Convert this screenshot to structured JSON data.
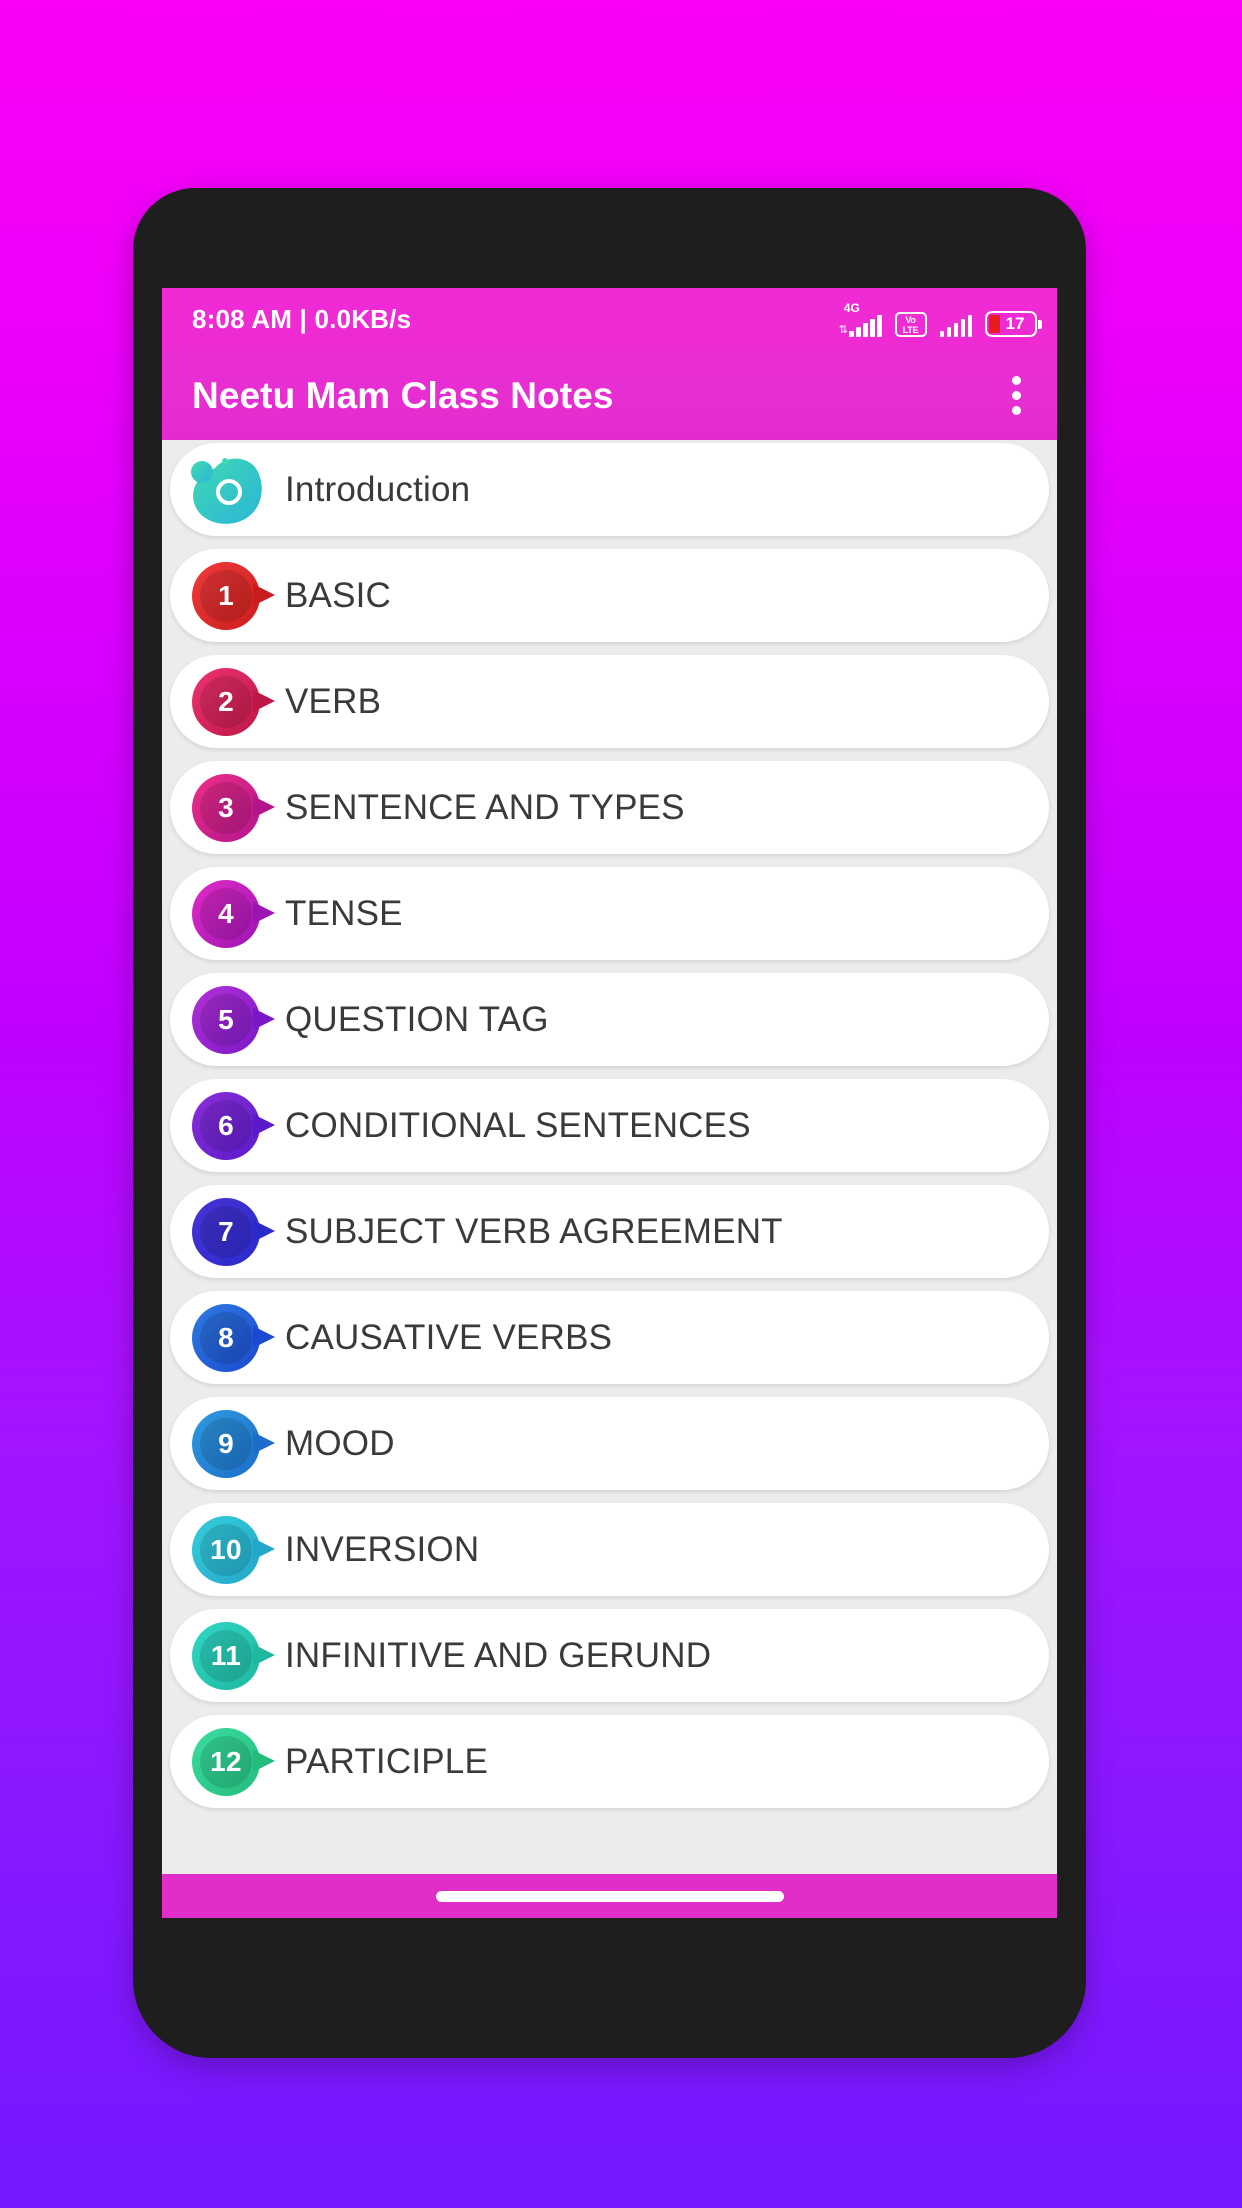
{
  "background": {
    "gradient_start": "#FB00F5",
    "gradient_end": "#7318FF"
  },
  "status_bar": {
    "clock": "8:08 AM | 0.0KB/s",
    "network_label": "4G",
    "data_arrows": "⇅",
    "volte_top": "Vo",
    "volte_bottom": "LTE",
    "battery_percent": "17",
    "background_color": "#F02BD6"
  },
  "app_bar": {
    "title": "Neetu Mam Class Notes",
    "background_color": "#E92FD4",
    "overflow_icon": "overflow-menu-icon"
  },
  "list": {
    "items": [
      {
        "number": "0",
        "label": "Introduction",
        "shape": "blob",
        "c1": "#3FD9B2",
        "c2": "#2BB6D8"
      },
      {
        "number": "1",
        "label": "BASIC",
        "shape": "bubble",
        "c1": "#EF3B3B",
        "c2": "#C91D1D"
      },
      {
        "number": "2",
        "label": "VERB",
        "shape": "bubble",
        "c1": "#EE3372",
        "c2": "#BC1745"
      },
      {
        "number": "3",
        "label": "SENTENCE AND TYPES",
        "shape": "bubble",
        "c1": "#ED2E86",
        "c2": "#B2158C"
      },
      {
        "number": "4",
        "label": "TENSE",
        "shape": "bubble",
        "c1": "#E22BC6",
        "c2": "#9C14B4"
      },
      {
        "number": "5",
        "label": "QUESTION TAG",
        "shape": "bubble",
        "c1": "#B431D6",
        "c2": "#7A18C6"
      },
      {
        "number": "6",
        "label": "CONDITIONAL SENTENCES",
        "shape": "bubble",
        "c1": "#8B2FD8",
        "c2": "#5A1ACB"
      },
      {
        "number": "7",
        "label": "SUBJECT VERB AGREEMENT",
        "shape": "bubble",
        "c1": "#4733D4",
        "c2": "#2A2ACB"
      },
      {
        "number": "8",
        "label": "CAUSATIVE VERBS",
        "shape": "bubble",
        "c1": "#2E7BE0",
        "c2": "#1B49CF"
      },
      {
        "number": "9",
        "label": "MOOD",
        "shape": "bubble",
        "c1": "#2E9BDE",
        "c2": "#1C6DC9"
      },
      {
        "number": "10",
        "label": "INVERSION",
        "shape": "bubble",
        "c1": "#35CEDC",
        "c2": "#23A7C9"
      },
      {
        "number": "11",
        "label": "INFINITIVE AND GERUND",
        "shape": "bubble",
        "c1": "#2FD8C6",
        "c2": "#1FB79E"
      },
      {
        "number": "12",
        "label": "PARTICIPLE",
        "shape": "bubble",
        "c1": "#3BDDA0",
        "c2": "#24BC7C"
      }
    ]
  },
  "bottom_nav": {
    "background_color": "#E22EC9",
    "home_indicator": "home-indicator"
  }
}
